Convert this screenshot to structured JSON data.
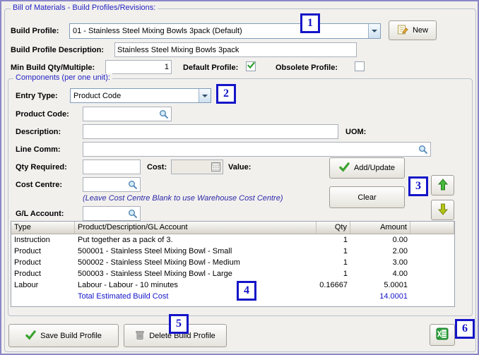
{
  "window": {
    "title": "Bill of Materials - Build Profiles/Revisions:"
  },
  "profile": {
    "build_profile_label": "Build Profile:",
    "build_profile_value": "01 - Stainless Steel Mixing Bowls 3pack (Default)",
    "new_button_label": "New",
    "description_label": "Build Profile Description:",
    "description_value": "Stainless Steel Mixing Bowls 3pack",
    "min_build_qty_label": "Min Build Qty/Multiple:",
    "min_build_qty_value": "1",
    "default_profile_label": "Default Profile:",
    "obsolete_profile_label": "Obsolete Profile:"
  },
  "components": {
    "title": "Components (per one unit):",
    "entry_type_label": "Entry Type:",
    "entry_type_value": "Product Code",
    "product_code_label": "Product Code:",
    "product_code_value": "",
    "description_label": "Description:",
    "description_value": "",
    "uom_label": "UOM:",
    "line_comm_label": "Line Comm:",
    "line_comm_value": "",
    "qty_required_label": "Qty Required:",
    "qty_required_value": "",
    "cost_label": "Cost:",
    "cost_value": "",
    "value_label": "Value:",
    "add_update_button_label": "Add/Update",
    "cost_centre_label": "Cost Centre:",
    "cost_centre_value": "",
    "cost_centre_note": "(Leave Cost Centre Blank to use Warehouse Cost Centre)",
    "clear_button_label": "Clear",
    "gl_account_label": "G/L Account:",
    "gl_account_value": ""
  },
  "grid": {
    "headers": {
      "type": "Type",
      "description": "Product/Description/GL Account",
      "qty": "Qty",
      "amount": "Amount"
    },
    "rows": [
      {
        "type": "Instruction",
        "description": "Put together as a pack of 3.",
        "qty": "1",
        "amount": "0.00"
      },
      {
        "type": "Product",
        "description": "500001 - Stainless Steel Mixing Bowl - Small",
        "qty": "1",
        "amount": "2.00"
      },
      {
        "type": "Product",
        "description": "500002 - Stainless Steel Mixing Bowl - Medium",
        "qty": "1",
        "amount": "3.00"
      },
      {
        "type": "Product",
        "description": "500003 - Stainless Steel Mixing Bowl - Large",
        "qty": "1",
        "amount": "4.00"
      },
      {
        "type": "Labour",
        "description": "Labour - Labour - 10 minutes",
        "qty": "0.16667",
        "amount": "5.0001"
      },
      {
        "type": "",
        "description": "Total Estimated Build Cost",
        "qty": "",
        "amount": "14.0001"
      }
    ]
  },
  "footer": {
    "save_button_label": "Save Build Profile",
    "delete_button_label": "Delete Build Profile"
  },
  "annotations": {
    "n1": "1",
    "n2": "2",
    "n3": "3",
    "n4": "4",
    "n5": "5",
    "n6": "6"
  },
  "colors": {
    "accent_blue": "#1414c8",
    "title_blue": "#2424c4",
    "check_green": "#2e9e2e"
  }
}
